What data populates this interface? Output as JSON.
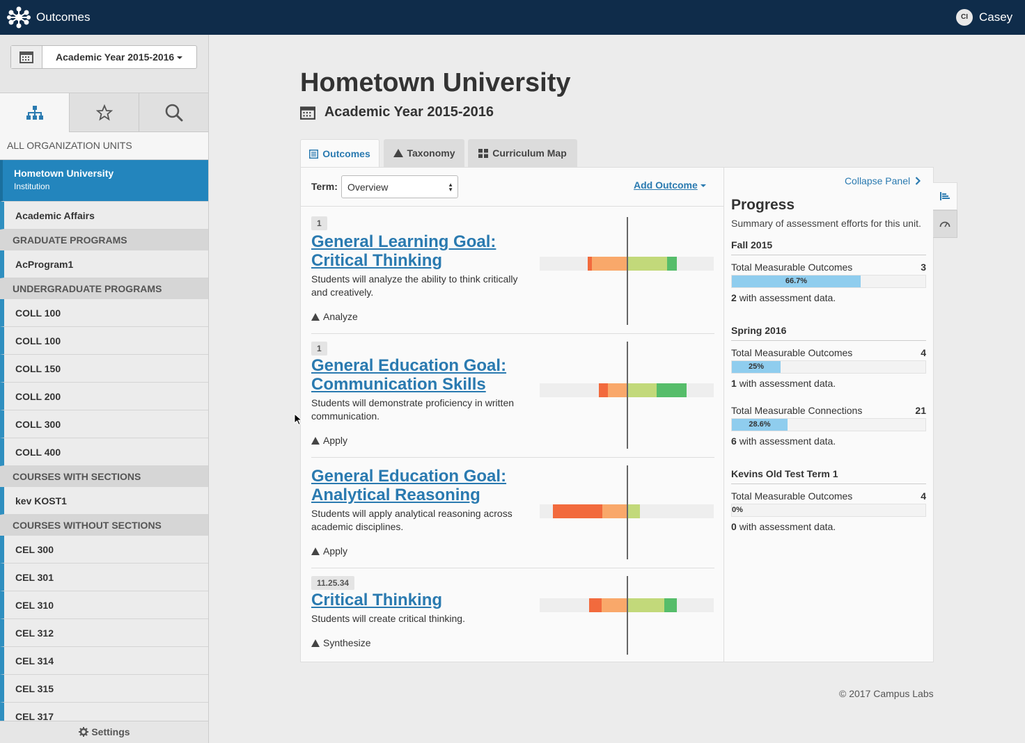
{
  "app": {
    "title": "Outcomes",
    "user_initials": "CI",
    "user_name": "Casey"
  },
  "sidebar": {
    "year_picker_label": "Academic Year 2015-2016",
    "all_units_label": "ALL ORGANIZATION UNITS",
    "tabs": [
      "hierarchy-icon",
      "star-icon",
      "search-icon"
    ],
    "selected_unit": {
      "name": "Hometown University",
      "type": "Institution"
    },
    "rows": [
      {
        "kind": "item",
        "label": "Academic Affairs"
      },
      {
        "kind": "header",
        "label": "GRADUATE PROGRAMS"
      },
      {
        "kind": "item",
        "label": "AcProgram1"
      },
      {
        "kind": "header",
        "label": "UNDERGRADUATE PROGRAMS"
      },
      {
        "kind": "item",
        "label": "COLL 100"
      },
      {
        "kind": "item",
        "label": "COLL 100"
      },
      {
        "kind": "item",
        "label": "COLL 150"
      },
      {
        "kind": "item",
        "label": "COLL 200"
      },
      {
        "kind": "item",
        "label": "COLL 300"
      },
      {
        "kind": "item",
        "label": "COLL 400"
      },
      {
        "kind": "header",
        "label": "COURSES WITH SECTIONS"
      },
      {
        "kind": "item",
        "label": "kev KOST1"
      },
      {
        "kind": "header",
        "label": "COURSES WITHOUT SECTIONS"
      },
      {
        "kind": "item",
        "label": "CEL 300"
      },
      {
        "kind": "item",
        "label": "CEL 301"
      },
      {
        "kind": "item",
        "label": "CEL 310"
      },
      {
        "kind": "item",
        "label": "CEL 312"
      },
      {
        "kind": "item",
        "label": "CEL 314"
      },
      {
        "kind": "item",
        "label": "CEL 315"
      },
      {
        "kind": "item",
        "label": "CEL 317"
      }
    ],
    "settings_label": "Settings"
  },
  "main": {
    "title": "Hometown University",
    "subtitle": "Academic Year 2015-2016",
    "tabs": [
      {
        "label": "Outcomes",
        "icon": "list-icon",
        "active": true
      },
      {
        "label": "Taxonomy",
        "icon": "pyramid-icon",
        "active": false
      },
      {
        "label": "Curriculum Map",
        "icon": "grid-icon",
        "active": false
      }
    ],
    "term_label": "Term:",
    "term_value": "Overview",
    "add_outcome_label": "Add Outcome",
    "outcomes": [
      {
        "badge": "1",
        "title_lines": [
          "General Learning Goal:",
          "Critical Thinking"
        ],
        "description_lines": [
          "Students will analyze the ability to think critically",
          "and creatively."
        ],
        "level": "Analyze",
        "distribution": [
          0.024,
          0.2,
          0.232,
          0.056
        ]
      },
      {
        "badge": "1",
        "title_lines": [
          "General Education Goal:",
          "Communication Skills"
        ],
        "description_lines": [
          "Students will demonstrate proficiency in written",
          "communication."
        ],
        "level": "Apply",
        "distribution": [
          0.052,
          0.108,
          0.172,
          0.172
        ]
      },
      {
        "badge": "",
        "title_lines": [
          "General Education Goal:",
          "Analytical Reasoning"
        ],
        "description_lines": [
          "Students will apply analytical reasoning across",
          "academic disciplines."
        ],
        "level": "Apply",
        "distribution": [
          0.284,
          0.14,
          0.076,
          0.0
        ]
      },
      {
        "badge": "11.25.34",
        "title_lines": [
          "Critical Thinking"
        ],
        "description_lines": [
          "Students will create critical thinking."
        ],
        "level": "Synthesize",
        "distribution": [
          0.072,
          0.144,
          0.216,
          0.072
        ]
      }
    ]
  },
  "progress": {
    "collapse_label": "Collapse Panel",
    "title": "Progress",
    "subtitle": "Summary of assessment efforts for this unit.",
    "terms": [
      {
        "name": "Fall 2015",
        "metrics": [
          {
            "label": "Total Measurable Outcomes",
            "total": "3",
            "percent_label": "66.7%",
            "fraction": 0.667,
            "count": "2",
            "note": "with assessment data."
          }
        ]
      },
      {
        "name": "Spring 2016",
        "metrics": [
          {
            "label": "Total Measurable Outcomes",
            "total": "4",
            "percent_label": "25%",
            "fraction": 0.25,
            "count": "1",
            "note": "with assessment data."
          },
          {
            "label": "Total Measurable Connections",
            "total": "21",
            "percent_label": "28.6%",
            "fraction": 0.286,
            "count": "6",
            "note": "with assessment data."
          }
        ]
      },
      {
        "name": "Kevins Old Test Term 1",
        "metrics": [
          {
            "label": "Total Measurable Outcomes",
            "total": "4",
            "percent_label": "0%",
            "fraction": 0.0,
            "count": "0",
            "note": "with assessment data."
          }
        ]
      }
    ]
  },
  "footer": "© 2017 Campus Labs",
  "colors": {
    "dark_red": "#f26a3d",
    "orange": "#f9a86a",
    "light_green": "#c2d97a",
    "green": "#56bd6a",
    "accent": "#2a7ab0",
    "topbar": "#0f2c4a"
  }
}
